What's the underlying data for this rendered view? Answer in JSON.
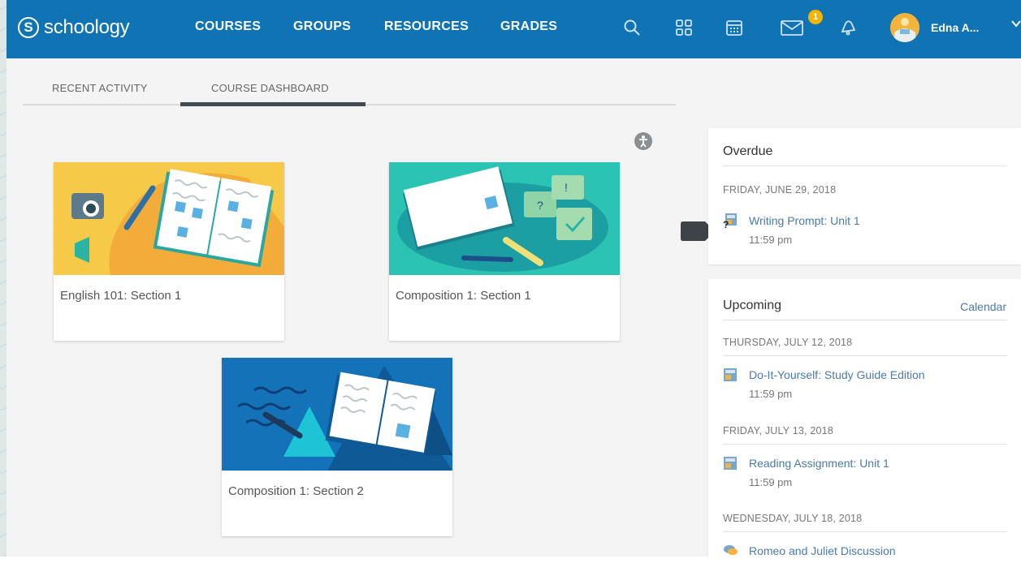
{
  "brand": {
    "name": "schoology",
    "logo_letter": "S"
  },
  "nav": {
    "links": [
      "COURSES",
      "GROUPS",
      "RESOURCES",
      "GRADES"
    ],
    "messages_badge": "1",
    "user_name": "Edna A...",
    "icons": [
      "search-icon",
      "apps-grid-icon",
      "calendar-icon",
      "mail-icon",
      "notifications-icon",
      "chevron-down-icon"
    ]
  },
  "tabs": {
    "recent": "RECENT ACTIVITY",
    "dashboard": "COURSE DASHBOARD",
    "active": "COURSE DASHBOARD"
  },
  "courses": [
    {
      "title": "English 101: Section 1",
      "color": "#f7c948"
    },
    {
      "title": "Composition 1: Section 1",
      "color": "#2bc4b4"
    },
    {
      "title": "Composition 1: Section 2",
      "color": "#1473b8"
    }
  ],
  "overdue": {
    "heading": "Overdue",
    "groups": [
      {
        "date": "FRIDAY, JUNE 29, 2018",
        "items": [
          {
            "title": "Writing Prompt: Unit 1",
            "time": "11:59 pm",
            "icon": "assignment-icon"
          }
        ]
      }
    ]
  },
  "upcoming": {
    "heading": "Upcoming",
    "calendar_link": "Calendar",
    "groups": [
      {
        "date": "THURSDAY, JULY 12, 2018",
        "items": [
          {
            "title": "Do-It-Yourself: Study Guide Edition",
            "time": "11:59 pm",
            "icon": "assignment-icon"
          }
        ]
      },
      {
        "date": "FRIDAY, JULY 13, 2018",
        "items": [
          {
            "title": "Reading Assignment: Unit 1",
            "time": "11:59 pm",
            "icon": "assignment-icon"
          }
        ]
      },
      {
        "date": "WEDNESDAY, JULY 18, 2018",
        "items": [
          {
            "title": "Romeo and Juliet Discussion",
            "icon": "discussion-icon"
          }
        ]
      }
    ]
  },
  "colors": {
    "nav_bg": "#0f73b4",
    "link": "#4a7aa8",
    "badge": "#f4b400"
  }
}
